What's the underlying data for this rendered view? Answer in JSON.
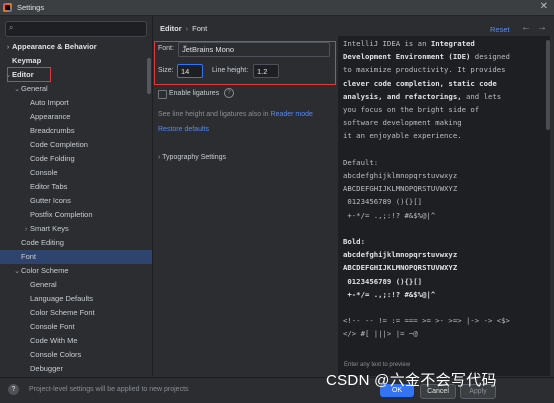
{
  "window": {
    "title": "Settings"
  },
  "sidebar": {
    "items": [
      {
        "label": "Appearance & Behavior",
        "arrow": "›",
        "bold": true
      },
      {
        "label": "Keymap",
        "arrow": "",
        "bold": true
      },
      {
        "label": "Editor",
        "arrow": "⌄",
        "bold": true
      },
      {
        "label": "General",
        "arrow": "⌄",
        "bold": false
      },
      {
        "label": "Auto Import",
        "arrow": "",
        "bold": false
      },
      {
        "label": "Appearance",
        "arrow": "",
        "bold": false
      },
      {
        "label": "Breadcrumbs",
        "arrow": "",
        "bold": false
      },
      {
        "label": "Code Completion",
        "arrow": "",
        "bold": false
      },
      {
        "label": "Code Folding",
        "arrow": "",
        "bold": false
      },
      {
        "label": "Console",
        "arrow": "",
        "bold": false
      },
      {
        "label": "Editor Tabs",
        "arrow": "",
        "bold": false
      },
      {
        "label": "Gutter Icons",
        "arrow": "",
        "bold": false
      },
      {
        "label": "Postfix Completion",
        "arrow": "",
        "bold": false
      },
      {
        "label": "Smart Keys",
        "arrow": "›",
        "bold": false
      },
      {
        "label": "Code Editing",
        "arrow": "",
        "bold": false
      },
      {
        "label": "Font",
        "arrow": "",
        "bold": false
      },
      {
        "label": "Color Scheme",
        "arrow": "⌄",
        "bold": false
      },
      {
        "label": "General",
        "arrow": "",
        "bold": false
      },
      {
        "label": "Language Defaults",
        "arrow": "",
        "bold": false
      },
      {
        "label": "Color Scheme Font",
        "arrow": "",
        "bold": false
      },
      {
        "label": "Console Font",
        "arrow": "",
        "bold": false
      },
      {
        "label": "Code With Me",
        "arrow": "",
        "bold": false
      },
      {
        "label": "Console Colors",
        "arrow": "",
        "bold": false
      },
      {
        "label": "Debugger",
        "arrow": "",
        "bold": false
      }
    ]
  },
  "breadcrumb": {
    "first": "Editor",
    "sep": "›",
    "second": "Font"
  },
  "header": {
    "reset": "Reset",
    "back": "←",
    "forward": "→"
  },
  "font_settings": {
    "font_label": "Font:",
    "font_value": "JetBrains Mono",
    "size_label": "Size:",
    "size_value": "14",
    "line_height_label": "Line height:",
    "line_height_value": "1.2",
    "ligatures_label": "Enable ligatures",
    "ligatures_checked": false,
    "info_text": "See line height and ligatures also in",
    "reader_mode_link": "Reader mode",
    "restore_defaults": "Restore defaults",
    "typography_label": "Typography Settings"
  },
  "preview": {
    "intro_lines": [
      [
        {
          "t": "IntelliJ IDEA is an ",
          "b": false
        },
        {
          "t": "Integrated",
          "b": true
        }
      ],
      [
        {
          "t": "Development Environment (IDE)",
          "b": true
        },
        {
          "t": " designed",
          "b": false
        }
      ],
      [
        {
          "t": "to maximize productivity. It provides",
          "b": false
        }
      ],
      [
        {
          "t": "clever code completion, static code",
          "b": true
        }
      ],
      [
        {
          "t": "analysis, and refactorings,",
          "b": true
        },
        {
          "t": " and lets",
          "b": false
        }
      ],
      [
        {
          "t": "you focus on the bright side of",
          "b": false
        }
      ],
      [
        {
          "t": "software development making",
          "b": false
        }
      ],
      [
        {
          "t": "it an enjoyable experience.",
          "b": false
        }
      ]
    ],
    "default_header": "Default:",
    "default_lines": [
      "abcdefghijklmnopqrstuvwxyz",
      "ABCDEFGHIJKLMNOPQRSTUVWXYZ",
      " 0123456789 (){}[]",
      " +-*/= .,;:!? #&$%@|^"
    ],
    "bold_header": "Bold:",
    "bold_lines": [
      "abcdefghijklmnopqrstuvwxyz",
      "ABCDEFGHIJKLMNOPQRSTUVWXYZ",
      " 0123456789 (){}[]",
      " +-*/= .,;:!? #&$%@|^"
    ],
    "ligature_lines": [
      "<!-- -- != := === >= >- >=> |-> -> <$>",
      "</> #[ |||> |= ~@"
    ],
    "hint": "Enter any text to preview"
  },
  "footer": {
    "help": "?",
    "info": "Project-level settings will be applied to new projects",
    "ok": "OK",
    "cancel": "Cancel",
    "apply": "Apply"
  },
  "watermark": "CSDN @六金不会写代码",
  "colors": {
    "accent": "#3574f0",
    "selection": "#2e436e",
    "highlight_box": "#e23a3a",
    "link": "#548af7"
  }
}
